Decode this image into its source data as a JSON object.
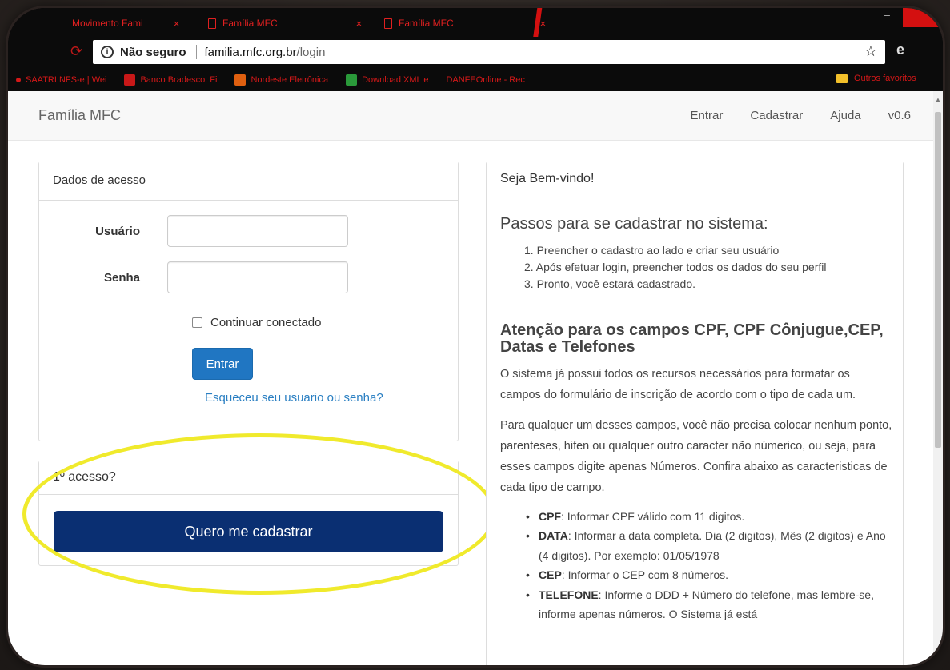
{
  "browser": {
    "tabs": [
      {
        "label": "Movimento Fami"
      },
      {
        "label": "Família MFC"
      },
      {
        "label": "Família MFC"
      }
    ],
    "omnibox": {
      "security_label": "Não seguro",
      "url_host": "familia.mfc.org.br",
      "url_path": "/login"
    },
    "bookmarks": [
      {
        "label": "SAATRI NFS-e | Wei"
      },
      {
        "label": "Banco Bradesco: Fi"
      },
      {
        "label": "Nordeste Eletrônica"
      },
      {
        "label": "Download XML e"
      },
      {
        "label": "DANFEOnline - Rec"
      }
    ],
    "other_favorites": "Outros favoritos"
  },
  "navbar": {
    "brand": "Família MFC",
    "links": [
      "Entrar",
      "Cadastrar",
      "Ajuda",
      "v0.6"
    ]
  },
  "login_panel": {
    "heading": "Dados de acesso",
    "user_label": "Usuário",
    "pass_label": "Senha",
    "remember_label": "Continuar conectado",
    "submit_label": "Entrar",
    "forgot_link": "Esqueceu seu usuario ou senha?"
  },
  "first_access_panel": {
    "heading": "1º acesso?",
    "button_label": "Quero me cadastrar"
  },
  "welcome_panel": {
    "heading": "Seja Bem-vindo!",
    "steps_title": "Passos para se cadastrar no sistema:",
    "steps": [
      "1. Preencher o cadastro ao lado e criar seu usuário",
      "2. Após efetuar login, preencher todos os dados do seu perfil",
      "3. Pronto, você estará cadastrado."
    ],
    "attention_title": "Atenção para os campos CPF, CPF Cônjugue,CEP, Datas e Telefones",
    "para1": "O sistema já possui todos os recursos necessários para formatar os campos do formulário de inscrição de acordo com o tipo de cada um.",
    "para2": "Para qualquer um desses campos, você não precisa colocar nenhum ponto, parenteses, hifen ou qualquer outro caracter não númerico, ou seja, para esses campos digite apenas Números. Confira abaixo as caracteristicas de cada tipo de campo.",
    "fields": [
      {
        "name": "CPF",
        "desc": ": Informar CPF válido com 11 digitos."
      },
      {
        "name": "DATA",
        "desc": ": Informar a data completa. Dia (2 digitos), Mês (2 digitos) e Ano (4 digitos). Por exemplo: 01/05/1978"
      },
      {
        "name": "CEP",
        "desc": ": Informar o CEP com 8 números."
      },
      {
        "name": "TELEFONE",
        "desc": ": Informe o DDD + Número do telefone, mas lembre-se, informe apenas números. O Sistema já está"
      }
    ]
  },
  "colors": {
    "primary_button": "#2076c2",
    "register_button": "#0a2f72",
    "highlight": "#f0ea2c",
    "tab_text": "#e02020"
  }
}
